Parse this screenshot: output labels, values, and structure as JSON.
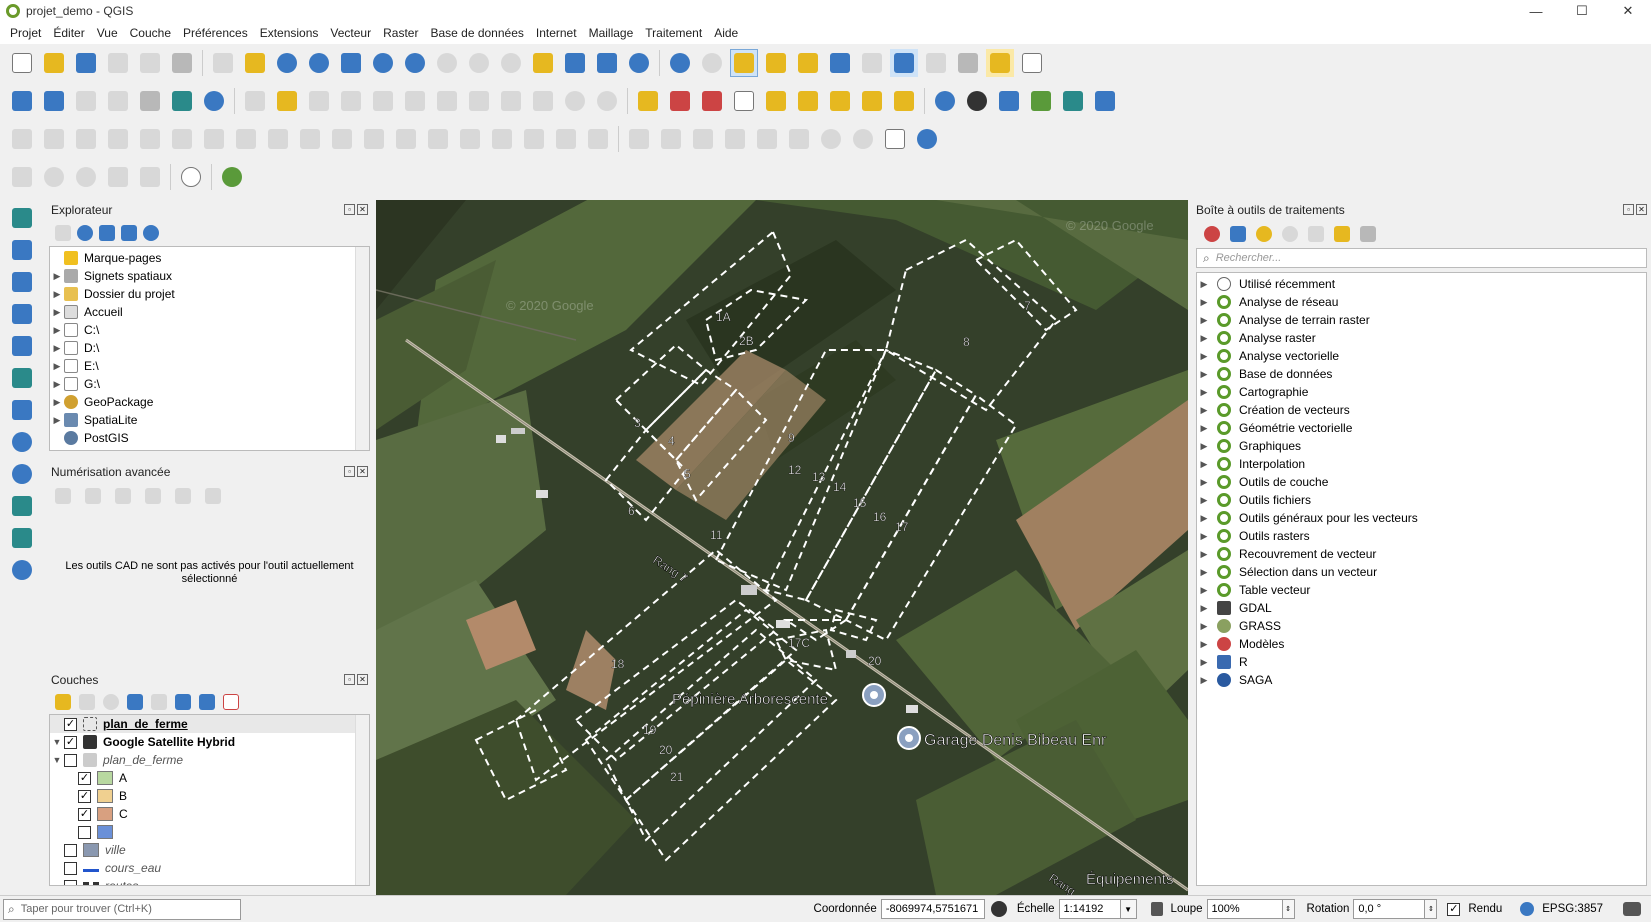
{
  "window": {
    "title": "projet_demo - QGIS",
    "controls": {
      "minimize": "—",
      "maximize": "☐",
      "close": "✕"
    }
  },
  "menu": [
    "Projet",
    "Éditer",
    "Vue",
    "Couche",
    "Préférences",
    "Extensions",
    "Vecteur",
    "Raster",
    "Base de données",
    "Internet",
    "Maillage",
    "Traitement",
    "Aide"
  ],
  "browser": {
    "title": "Explorateur",
    "items": [
      {
        "label": "Marque-pages",
        "icon": "star-icon",
        "expand": false
      },
      {
        "label": "Signets spatiaux",
        "icon": "bookmark-icon",
        "expand": true
      },
      {
        "label": "Dossier du projet",
        "icon": "folder-icon",
        "expand": true
      },
      {
        "label": "Accueil",
        "icon": "home-icon",
        "expand": true
      },
      {
        "label": "C:\\",
        "icon": "drive-icon",
        "expand": true
      },
      {
        "label": "D:\\",
        "icon": "drive-icon",
        "expand": true
      },
      {
        "label": "E:\\",
        "icon": "drive-icon",
        "expand": true
      },
      {
        "label": "G:\\",
        "icon": "drive-icon",
        "expand": true
      },
      {
        "label": "GeoPackage",
        "icon": "geopackage-icon",
        "expand": true
      },
      {
        "label": "SpatiaLite",
        "icon": "spatialite-icon",
        "expand": true
      },
      {
        "label": "PostGIS",
        "icon": "postgis-icon",
        "expand": false
      }
    ]
  },
  "digitizing": {
    "title": "Numérisation avancée",
    "message": "Les outils CAD ne sont pas activés pour l'outil actuellement sélectionné"
  },
  "layers": {
    "title": "Couches",
    "items": [
      {
        "label": "plan_de_ferme",
        "checked": true,
        "style": "bold-underline",
        "indent": 0,
        "expand": false
      },
      {
        "label": "Google Satellite Hybrid",
        "checked": true,
        "style": "bold",
        "indent": 0,
        "expand": true
      },
      {
        "label": "plan_de_ferme",
        "checked": false,
        "style": "italic",
        "indent": 0,
        "expand": true
      },
      {
        "label": "A",
        "checked": true,
        "style": "normal",
        "indent": 1,
        "swatch": "#b8d8a0"
      },
      {
        "label": "B",
        "checked": true,
        "style": "normal",
        "indent": 1,
        "swatch": "#f0d090"
      },
      {
        "label": "C",
        "checked": true,
        "style": "normal",
        "indent": 1,
        "swatch": "#d8a080"
      },
      {
        "label": "",
        "checked": false,
        "style": "normal",
        "indent": 1,
        "swatch": "#6a90d8"
      },
      {
        "label": "ville",
        "checked": false,
        "style": "italic",
        "indent": 0,
        "swatch": "#8a98b0"
      },
      {
        "label": "cours_eau",
        "checked": false,
        "style": "italic",
        "indent": 0,
        "swatch": "#2255cc"
      },
      {
        "label": "routes",
        "checked": false,
        "style": "italic",
        "indent": 0,
        "swatch": "#333333"
      }
    ]
  },
  "processing": {
    "title": "Boîte à outils de traitements",
    "search_placeholder": "Rechercher...",
    "items": [
      "Utilisé récemment",
      "Analyse de réseau",
      "Analyse de terrain raster",
      "Analyse raster",
      "Analyse vectorielle",
      "Base de données",
      "Cartographie",
      "Création de vecteurs",
      "Géométrie vectorielle",
      "Graphiques",
      "Interpolation",
      "Outils de couche",
      "Outils fichiers",
      "Outils généraux pour les vecteurs",
      "Outils rasters",
      "Recouvrement de vecteur",
      "Sélection dans un vecteur",
      "Table vecteur",
      "GDAL",
      "GRASS",
      "Modèles",
      "R",
      "SAGA"
    ]
  },
  "map": {
    "watermarks": [
      "© 2020 Google",
      "© 2020 Google"
    ],
    "plot_labels": [
      "1A",
      "2B",
      "3",
      "4",
      "5",
      "6",
      "7",
      "8",
      "9",
      "11",
      "12",
      "13",
      "14",
      "15",
      "16",
      "17",
      "17C",
      "18",
      "19",
      "20",
      "20",
      "21"
    ],
    "road_label_1": "Rang 7",
    "road_label_2": "Rang",
    "poi_1": "Pépinière Arborescente",
    "poi_2": "Garage Denis Bibeau Enr",
    "poi_3": "Équipements"
  },
  "status": {
    "search_placeholder": "Taper pour trouver (Ctrl+K)",
    "coord_label": "Coordonnée",
    "coord_value": "-8069974,5751671",
    "scale_label": "Échelle",
    "scale_value": "1:14192",
    "magnifier_label": "Loupe",
    "magnifier_value": "100%",
    "rotation_label": "Rotation",
    "rotation_value": "0,0 °",
    "render_label": "Rendu",
    "crs": "EPSG:3857"
  }
}
